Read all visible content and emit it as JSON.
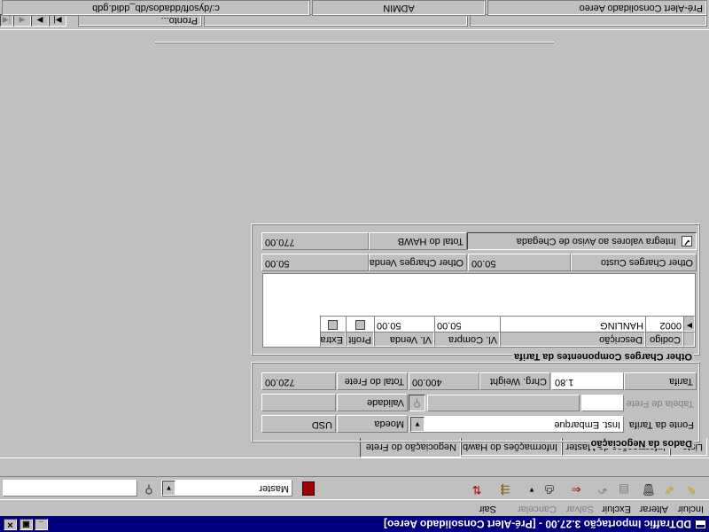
{
  "window": {
    "title": "DDTraffic Importação 3.27.00 - [Pré-Alert Consolidado Aereo]"
  },
  "menu": {
    "incluir": "Incluir",
    "alterar": "Alterar",
    "excluir": "Excluir",
    "salvar": "Salvar",
    "cancelar": "Cancelar",
    "sair": "Sair"
  },
  "toolbar": {
    "master_select": "Master",
    "search_value": ""
  },
  "tabs": [
    "Lista",
    "Informações do Master",
    "Informações do Hawb",
    "Negociação do Frete"
  ],
  "active_tab": 3,
  "negociacao": {
    "group_title": "Dados da Negociação",
    "fonte_label": "Fonte da Tarifa",
    "fonte_value": "Inst. Embarque",
    "moeda_label": "Moeda",
    "moeda_value": "USD",
    "tabela_label": "Tabela de Frete",
    "tabela_code": "",
    "tabela_desc": "",
    "validade_label": "Validade",
    "validade_value": "",
    "tarifa_label": "Tarifa",
    "tarifa_value": "1.80",
    "chg_label": "Chrg. Weight",
    "chg_value": "400.00",
    "total_frete_label": "Total do Frete",
    "total_frete_value": "720.00"
  },
  "other_charges": {
    "group_title": "Other Charges Componentes da Tarifa",
    "columns": [
      "Codigo",
      "Descrição",
      "Vl. Compra",
      "Vl. Venda",
      "Profit",
      "Extra"
    ],
    "rows": [
      {
        "codigo": "0002",
        "descricao": "HANLING",
        "compra": "50.00",
        "venda": "50.00"
      }
    ],
    "custo_label": "Other Charges Custo",
    "custo_value": "50.00",
    "venda_label": "Other Charges Venda",
    "venda_value": "50.00",
    "integra_label": "Integra valores ao Aviso de Chegada",
    "integra_checked": true,
    "total_hawb_label": "Total do HAWB",
    "total_hawb_value": "770.00"
  },
  "status": {
    "pronto": "Pronto...",
    "user": "ADMIN",
    "path": "c:/dysoft/ddados/db_ddid.gdb",
    "form": "Pré-Alert Consolidado Aereo"
  }
}
